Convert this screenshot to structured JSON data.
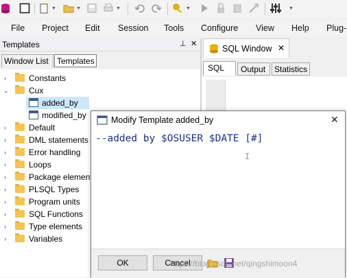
{
  "menu": [
    "File",
    "Project",
    "Edit",
    "Session",
    "Tools",
    "Configure",
    "View",
    "Help",
    "Plug-"
  ],
  "toolbar_icons": [
    "db-icon",
    "stop-icon",
    "new-icon",
    "open-icon",
    "save-icon",
    "print-icon",
    "undo-icon",
    "redo-icon",
    "key-icon",
    "run-icon",
    "lock-icon",
    "commit-icon",
    "rollback-icon",
    "settings-icon"
  ],
  "left_panel": {
    "title": "Templates",
    "pin_glyph": "⊥",
    "close_glyph": "✕",
    "tabs": [
      "Window List",
      "Templates"
    ],
    "active_tab": "Templates",
    "tree": [
      {
        "label": "Constants",
        "type": "folder",
        "level": 0,
        "expanded": false
      },
      {
        "label": "Cux",
        "type": "folder",
        "level": 0,
        "expanded": true
      },
      {
        "label": "added_by",
        "type": "doc",
        "level": 1,
        "selected": true
      },
      {
        "label": "modified_by",
        "type": "doc",
        "level": 1
      },
      {
        "label": "Default",
        "type": "folder",
        "level": 0,
        "expanded": false
      },
      {
        "label": "DML statements",
        "type": "folder",
        "level": 0,
        "expanded": false
      },
      {
        "label": "Error handling",
        "type": "folder",
        "level": 0,
        "expanded": false
      },
      {
        "label": "Loops",
        "type": "folder",
        "level": 0,
        "expanded": false
      },
      {
        "label": "Package element",
        "type": "folder",
        "level": 0,
        "expanded": false
      },
      {
        "label": "PLSQL Types",
        "type": "folder",
        "level": 0,
        "expanded": false
      },
      {
        "label": "Program units",
        "type": "folder",
        "level": 0,
        "expanded": false
      },
      {
        "label": "SQL Functions",
        "type": "folder",
        "level": 0,
        "expanded": false
      },
      {
        "label": "Type elements",
        "type": "folder",
        "level": 0,
        "expanded": false
      },
      {
        "label": "Variables",
        "type": "folder",
        "level": 0,
        "expanded": false
      }
    ]
  },
  "right_panel": {
    "window_tab": "SQL Window",
    "close_glyph": "✕",
    "sub_tabs": [
      "SQL",
      "Output",
      "Statistics"
    ],
    "active_sub_tab": "SQL"
  },
  "dialog": {
    "title": "Modify Template added_by",
    "close_glyph": "✕",
    "content": "--added by $OSUSER $DATE [#]",
    "ok_label": "OK",
    "cancel_label": "Cancel",
    "watermark": "https://blog.csdn.net/qingshimoon4"
  },
  "colors": {
    "editor_text": "#1d2e8c",
    "selected_row": "#cce8ff",
    "folder": "#f5c451"
  }
}
